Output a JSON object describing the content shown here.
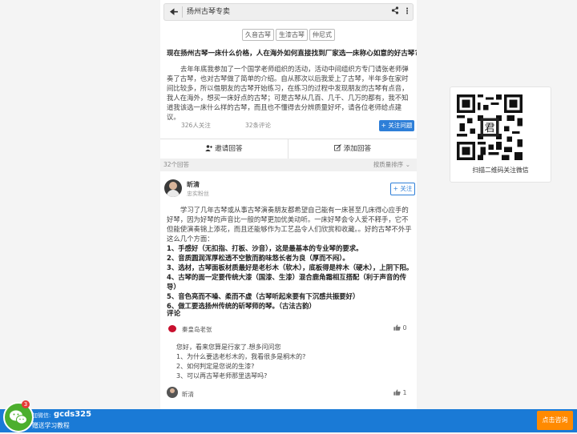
{
  "browser": {
    "title": "扬州古琴专卖"
  },
  "question": {
    "tags": [
      "久音古琴",
      "生漆古琴",
      "仲尼式"
    ],
    "title": "现在扬州古琴一床什么价格，人在海外如何直接找到厂家选一床称心如意的好古琴?",
    "body": "去年年底我参加了一个国学老师组织的活动，活动中间组织方专门请张老师弹奏了古琴，也对古琴做了简单的介绍。自从那次以后我爱上了古琴，半年多在家时间比较多，所以借朋友的古琴开始练习，在练习的过程中发现朋友的古琴有点音，我人在海外，想买一床好点的古琴；可是古琴从几百、几千、几万的都有，我不知道我该选一床什么样的古琴，而且也不懂得去分辨质量好坏，请各位老师给点建议。",
    "followers": "326人关注",
    "comments": "32条评论",
    "follow_button": "+ 关注问题"
  },
  "actions": {
    "invite": "邀请回答",
    "add_answer": "添加回答"
  },
  "answers_bar": {
    "count": "32个回答",
    "sort": "按质量排序"
  },
  "answer": {
    "author": "昕清",
    "role": "忠实粉丝",
    "follow": "+ 关注",
    "intro": "学习了几年古琴或从事古琴演奏朋友都希望自己能有一床甚至几床得心应手的好琴，因为好琴的声音比一般的琴更加优美动听。一床好琴会令人爱不释手，它不但能使演奏锦上添花，而且还能够作为工艺品令人们欣赏和收藏。。好的古琴不外乎这么几个方面：",
    "points": [
      "1、手感好（无扣指、打板、沙音），这是最基本的专业琴的要求。",
      "2、音质圆润浑厚松透不空散而韵味悠长者为良（厚而不闷）。",
      "3、选材，古琴面板材质最好是老杉木（软木），底板得是梓木（硬木），上阴下阳。",
      "4、古琴的面一定要传统大漆（国漆、生漆）混合鹿角霜相互搭配（利于声音的传导）",
      "5、音色亮而不噪、柔而不虚（古琴听起来要有下沉感共振要好）",
      "6、做工要选扬州传统的斫琴师的琴。（古法古韵）"
    ]
  },
  "comments_section": {
    "title": "评论",
    "items": [
      {
        "author": "秦皇岛老张",
        "likes": "0",
        "lines": [
          "您好，看来您算是行家了.想多问问您",
          "1、为什么要选老杉木的，我看很多是桐木的?",
          "2、如何判定是您说的生漆?",
          "3、可以再古琴老师那里选琴吗?"
        ]
      },
      {
        "author": "昕清",
        "likes": "1"
      }
    ]
  },
  "sidebar": {
    "qr_caption": "扫描二维码关注微信"
  },
  "bottom_bar": {
    "badge": "3",
    "label": "加微信:",
    "wechat_id": "gcds325",
    "subtitle": "赠送学习教程",
    "consult_button": "点击咨询"
  },
  "icons": {
    "back": "back-arrow-icon",
    "share": "share-icon",
    "more": "more-vertical-icon",
    "invite": "add-user-icon",
    "add_answer": "edit-icon",
    "like": "thumbs-up-icon",
    "wechat": "wechat-icon"
  },
  "colors": {
    "primary": "#2e7fd8",
    "bottom_bar": "#1a7ad6",
    "consult": "#ff8a00",
    "wechat": "#4caf2e"
  }
}
